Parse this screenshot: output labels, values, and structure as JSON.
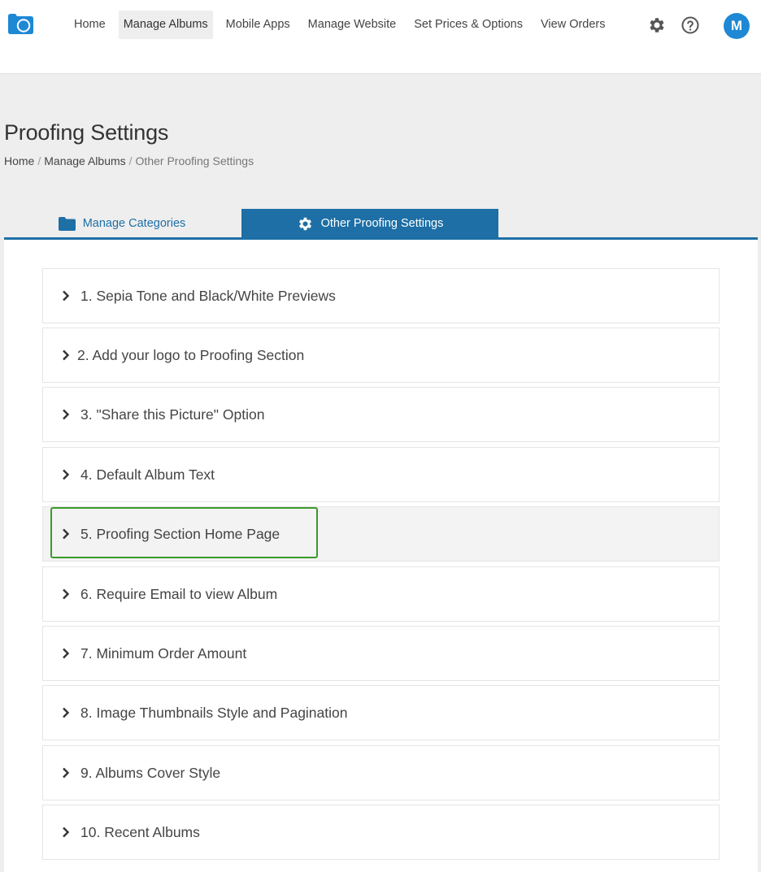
{
  "nav": {
    "items": [
      {
        "label": "Home",
        "active": false
      },
      {
        "label": "Manage Albums",
        "active": true
      },
      {
        "label": "Mobile Apps",
        "active": false
      },
      {
        "label": "Manage Website",
        "active": false
      },
      {
        "label": "Set Prices & Options",
        "active": false
      },
      {
        "label": "View Orders",
        "active": false
      }
    ],
    "settings_icon": "gear-icon",
    "help_icon": "question-circle-icon",
    "avatar_initial": "M",
    "accent_color": "#1e88d4"
  },
  "page": {
    "title": "Proofing Settings",
    "breadcrumb": [
      "Home",
      "Manage Albums",
      "Other Proofing Settings"
    ]
  },
  "tabs": [
    {
      "label": "Manage Categories",
      "icon": "folder-icon",
      "active": false
    },
    {
      "label": "Other Proofing Settings",
      "icon": "gear-icon",
      "active": true
    }
  ],
  "tab_color": "#1d6fa5",
  "accordion": {
    "items": [
      {
        "label": "1. Sepia Tone and Black/White Previews"
      },
      {
        "label": "2. Add your logo to Proofing Section"
      },
      {
        "label": "3. \"Share this Picture\" Option"
      },
      {
        "label": "4. Default Album Text"
      },
      {
        "label": "5. Proofing Section Home Page"
      },
      {
        "label": "6. Require Email to view Album"
      },
      {
        "label": "7. Minimum Order Amount"
      },
      {
        "label": "8. Image Thumbnails Style and Pagination"
      },
      {
        "label": "9. Albums Cover Style"
      },
      {
        "label": "10. Recent Albums"
      }
    ],
    "chevron_icon": "chevron-right-icon",
    "highlight_color": "#3a9a2a"
  }
}
